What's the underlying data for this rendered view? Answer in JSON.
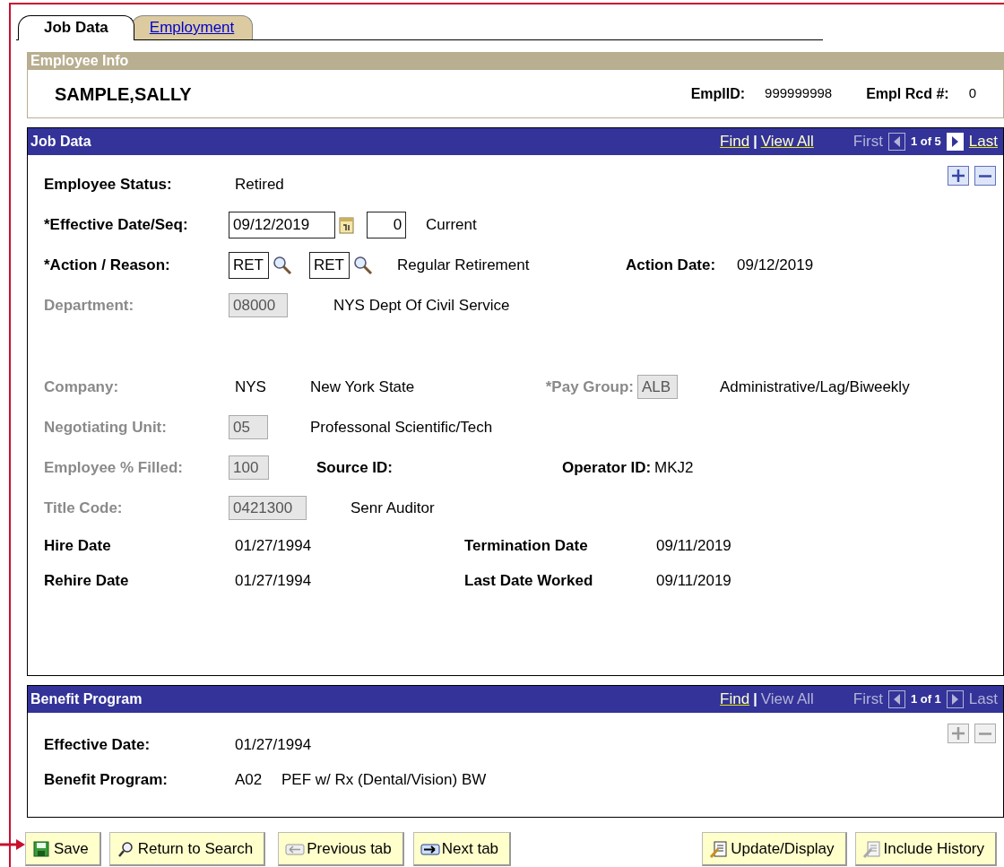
{
  "tabs": [
    {
      "label": "Job Data",
      "selected": true
    },
    {
      "label": "Employment",
      "selected": false
    }
  ],
  "employee_info": {
    "title": "Employee Info",
    "name": "SAMPLE,SALLY",
    "fields": [
      {
        "label": "EmplID:",
        "value": "999999998"
      },
      {
        "label": "Empl Rcd #:",
        "value": "0"
      }
    ]
  },
  "job_data": {
    "title": "Job Data",
    "nav": {
      "find": {
        "label": "Find",
        "enabled": true
      },
      "separator": "|",
      "view_all": {
        "label": "View All",
        "enabled": true
      },
      "first": {
        "label": "First",
        "enabled": false
      },
      "prev_enabled": false,
      "counter": "1 of 5",
      "next_enabled": true,
      "last": {
        "label": "Last",
        "enabled": true
      }
    },
    "add_enabled": true,
    "delete_enabled": true,
    "rows": [
      [
        {
          "kind": "label",
          "text": "Employee Status:",
          "disabled": false
        },
        {
          "kind": "text",
          "text": "Retired"
        }
      ],
      [
        {
          "kind": "label",
          "text": "*Effective Date/Seq:",
          "disabled": false
        },
        {
          "kind": "field",
          "value": "09/12/2019",
          "read_only": false,
          "has_calendar": true
        },
        {
          "kind": "field",
          "value": "0",
          "read_only": false,
          "right_aligned": true
        },
        {
          "kind": "text",
          "text": "Current"
        }
      ],
      [
        {
          "kind": "label",
          "text": "*Action / Reason:",
          "disabled": false
        },
        {
          "kind": "field",
          "value": "RET",
          "read_only": false,
          "has_lookup": true
        },
        {
          "kind": "field",
          "value": "RET",
          "read_only": false,
          "has_lookup": true
        },
        {
          "kind": "text",
          "text": "Regular Retirement"
        },
        {
          "kind": "label",
          "text": "Action Date:",
          "disabled": false
        },
        {
          "kind": "text",
          "text": "09/12/2019"
        }
      ],
      [
        {
          "kind": "label",
          "text": "Department:",
          "disabled": true
        },
        {
          "kind": "field",
          "value": "08000",
          "read_only": true
        },
        {
          "kind": "text",
          "text": "NYS Dept Of Civil Service"
        }
      ],
      [
        {
          "kind": "label",
          "text": "Company:",
          "disabled": true
        },
        {
          "kind": "text",
          "text": "NYS"
        },
        {
          "kind": "text",
          "text": "New York State"
        },
        {
          "kind": "label",
          "text": "*Pay Group:",
          "disabled": true
        },
        {
          "kind": "field",
          "value": "ALB",
          "read_only": true
        },
        {
          "kind": "text",
          "text": "Administrative/Lag/Biweekly"
        }
      ],
      [
        {
          "kind": "label",
          "text": "Negotiating Unit:",
          "disabled": true
        },
        {
          "kind": "field",
          "value": "05",
          "read_only": true
        },
        {
          "kind": "text",
          "text": "Professonal Scientific/Tech"
        }
      ],
      [
        {
          "kind": "label",
          "text": "Employee % Filled:",
          "disabled": true
        },
        {
          "kind": "field",
          "value": "100",
          "read_only": true
        },
        {
          "kind": "label",
          "text": "Source ID:",
          "disabled": false
        },
        {
          "kind": "label",
          "text": "Operator ID:",
          "disabled": false
        },
        {
          "kind": "text",
          "text": "MKJ2"
        }
      ],
      [
        {
          "kind": "label",
          "text": "Title Code:",
          "disabled": true
        },
        {
          "kind": "field",
          "value": "0421300",
          "read_only": true
        },
        {
          "kind": "text",
          "text": "Senr Auditor"
        }
      ],
      [
        {
          "kind": "label",
          "text": "Hire Date",
          "disabled": false
        },
        {
          "kind": "text",
          "text": "01/27/1994"
        },
        {
          "kind": "label",
          "text": "Termination Date",
          "disabled": false
        },
        {
          "kind": "text",
          "text": "09/11/2019"
        }
      ],
      [
        {
          "kind": "label",
          "text": "Rehire Date",
          "disabled": false
        },
        {
          "kind": "text",
          "text": "01/27/1994"
        },
        {
          "kind": "label",
          "text": "Last Date Worked",
          "disabled": false
        },
        {
          "kind": "text",
          "text": "09/11/2019"
        }
      ]
    ]
  },
  "benefit_program": {
    "title": "Benefit Program",
    "nav": {
      "find": {
        "label": "Find",
        "enabled": true
      },
      "separator": "|",
      "view_all": {
        "label": "View All",
        "enabled": false
      },
      "first": {
        "label": "First",
        "enabled": false
      },
      "prev_enabled": false,
      "counter": "1 of 1",
      "next_enabled": false,
      "last": {
        "label": "Last",
        "enabled": false
      }
    },
    "add_enabled": false,
    "delete_enabled": false,
    "rows": [
      [
        {
          "kind": "label",
          "text": "Effective Date:",
          "disabled": false
        },
        {
          "kind": "text",
          "text": "01/27/1994"
        }
      ],
      [
        {
          "kind": "label",
          "text": "Benefit Program:",
          "disabled": false
        },
        {
          "kind": "text",
          "text": "A02"
        },
        {
          "kind": "text",
          "text": "PEF w/ Rx (Dental/Vision) BW"
        }
      ]
    ]
  },
  "buttons_left": [
    {
      "kind": "save",
      "label": "Save"
    },
    {
      "kind": "search",
      "label": "Return to Search"
    },
    {
      "kind": "previous",
      "label": "Previous tab"
    },
    {
      "kind": "next",
      "label": "Next tab"
    }
  ],
  "buttons_right": [
    {
      "kind": "update",
      "label": "Update/Display"
    },
    {
      "kind": "history",
      "label": "Include History"
    }
  ]
}
